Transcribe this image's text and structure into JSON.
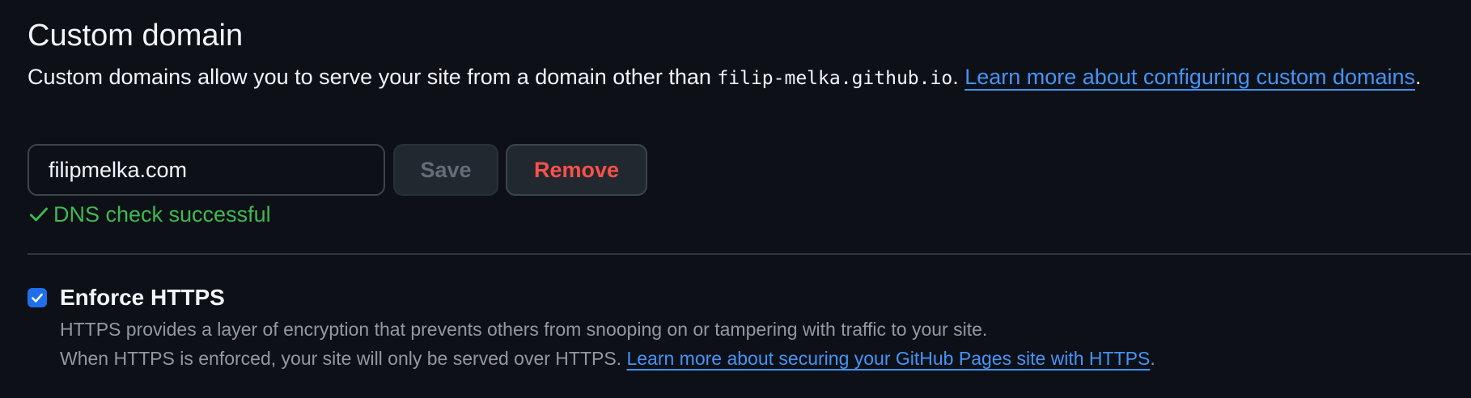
{
  "custom_domain": {
    "title": "Custom domain",
    "description_prefix": "Custom domains allow you to serve your site from a domain other than ",
    "default_domain": "filip-melka.github.io",
    "description_mid": ". ",
    "learn_more_link": "Learn more about configuring custom domains",
    "description_suffix": ".",
    "input_value": "filipmelka.com",
    "save_label": "Save",
    "remove_label": "Remove",
    "dns_status": "DNS check successful"
  },
  "enforce_https": {
    "label": "Enforce HTTPS",
    "checked": true,
    "line1": "HTTPS provides a layer of encryption that prevents others from snooping on or tampering with traffic to your site.",
    "line2_prefix": "When HTTPS is enforced, your site will only be served over HTTPS. ",
    "learn_more_link": "Learn more about securing your GitHub Pages site with HTTPS",
    "line2_suffix": "."
  },
  "colors": {
    "background": "#0d1117",
    "link": "#4493f8",
    "success": "#3fb950",
    "danger": "#f85149",
    "checkbox": "#1f6feb"
  },
  "icons": {
    "dns_status": "check-icon",
    "checkbox": "checkmark-icon"
  }
}
